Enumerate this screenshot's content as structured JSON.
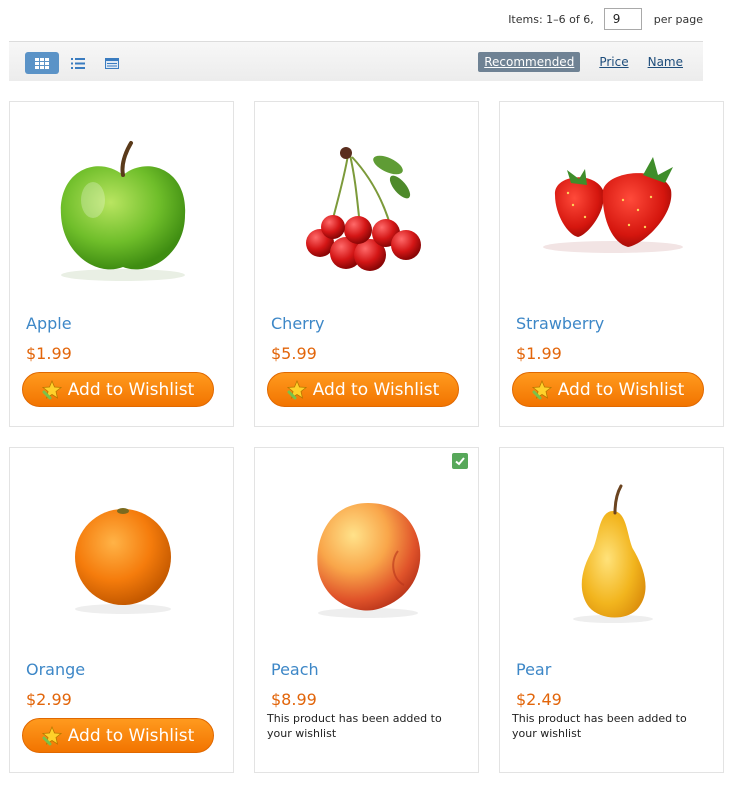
{
  "pager": {
    "items_label": "Items: 1–6 of 6,",
    "per_page_value": "9",
    "per_page_label": "per page"
  },
  "toolbar": {
    "views": [
      {
        "name": "grid",
        "icon": "grid-view-icon",
        "active": true
      },
      {
        "name": "list",
        "icon": "list-view-icon",
        "active": false
      },
      {
        "name": "table",
        "icon": "table-view-icon",
        "active": false
      }
    ],
    "sorts": [
      {
        "label": "Recommended",
        "active": true
      },
      {
        "label": "Price",
        "active": false
      },
      {
        "label": "Name",
        "active": false
      }
    ]
  },
  "products": [
    {
      "name": "Apple",
      "price": "$1.99",
      "in_wishlist": false,
      "button_label": "Add to Wishlist",
      "added_message": ""
    },
    {
      "name": "Cherry",
      "price": "$5.99",
      "in_wishlist": false,
      "button_label": "Add to Wishlist",
      "added_message": ""
    },
    {
      "name": "Strawberry",
      "price": "$1.99",
      "in_wishlist": false,
      "button_label": "Add to Wishlist",
      "added_message": ""
    },
    {
      "name": "Orange",
      "price": "$2.99",
      "in_wishlist": false,
      "button_label": "Add to Wishlist",
      "added_message": ""
    },
    {
      "name": "Peach",
      "price": "$8.99",
      "in_wishlist": true,
      "button_label": "",
      "added_message": "This product has been added to your wishlist"
    },
    {
      "name": "Pear",
      "price": "$2.49",
      "in_wishlist": true,
      "button_label": "",
      "added_message": "This product has been added to your wishlist"
    }
  ],
  "colors": {
    "accent_blue": "#5b93c7",
    "product_link": "#3d87c7",
    "price": "#e2650a",
    "button_orange": "#f27400",
    "check_green": "#57a85a"
  }
}
